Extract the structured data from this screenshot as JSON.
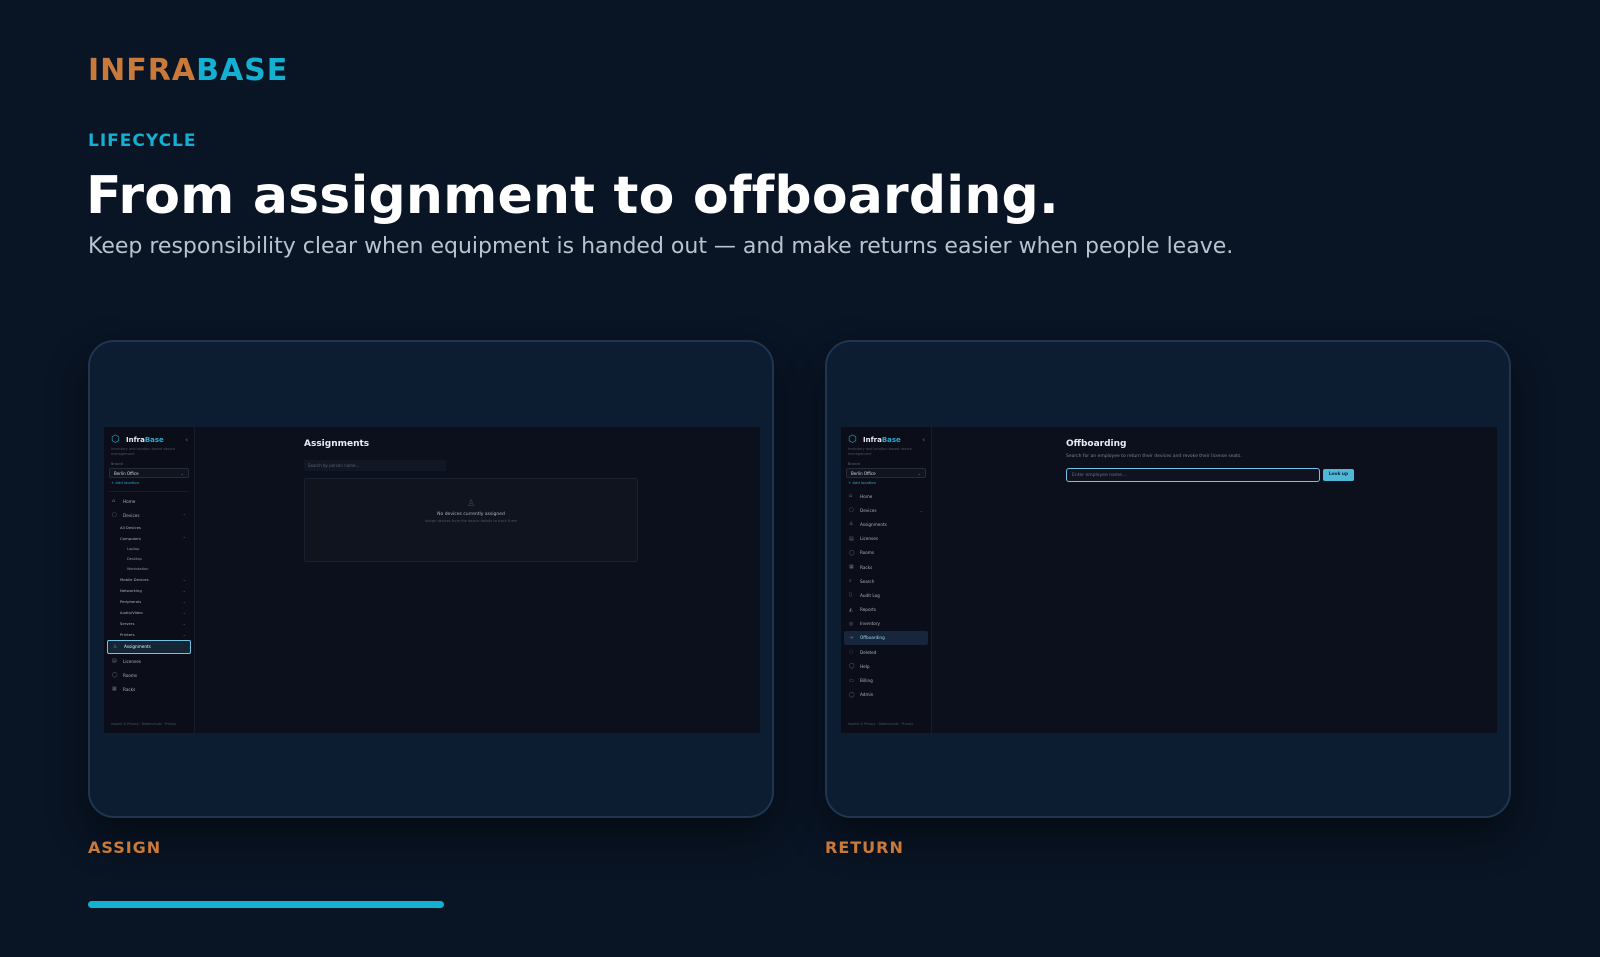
{
  "brand": {
    "part1": "INFRA",
    "part2": "BASE"
  },
  "eyebrow": "LIFECYCLE",
  "headline": "From assignment to offboarding.",
  "subhead": "Keep responsibility clear when equipment is handed out — and make returns easier when people leave.",
  "colors": {
    "accent_cyan": "#14b0d1",
    "accent_orange": "#c97a3a",
    "background": "#091424"
  },
  "cards": [
    {
      "caption": "ASSIGN",
      "app": {
        "brand_a": "Infra",
        "brand_b": "Base",
        "tagline": "Inventory and location-based device management",
        "location_label": "Branch",
        "location": "Berlin Office",
        "add_location": "+ Add location",
        "footer": "Imprint & Privacy · Datenschutz · Privacy",
        "nav": [
          {
            "label": "Home",
            "icon": "⌂"
          },
          {
            "label": "Devices",
            "icon": "▢"
          },
          {
            "label": "All Devices"
          },
          {
            "label": "Computers"
          },
          {
            "label": "Laptop"
          },
          {
            "label": "Desktop"
          },
          {
            "label": "Workstation"
          },
          {
            "label": "Mobile Devices"
          },
          {
            "label": "Networking"
          },
          {
            "label": "Peripherals"
          },
          {
            "label": "Audio/Video"
          },
          {
            "label": "Servers"
          },
          {
            "label": "Printers"
          },
          {
            "label": "Assignments",
            "icon": "♙"
          },
          {
            "label": "Licenses",
            "icon": "▤"
          },
          {
            "label": "Rooms",
            "icon": "◯"
          },
          {
            "label": "Racks",
            "icon": "▦"
          }
        ],
        "page_title": "Assignments",
        "search_placeholder": "Search by person name...",
        "empty_title": "No devices currently assigned",
        "empty_sub": "Assign devices from the device details to track them"
      }
    },
    {
      "caption": "RETURN",
      "app": {
        "brand_a": "Infra",
        "brand_b": "Base",
        "tagline": "Inventory and location-based device management",
        "location_label": "Branch",
        "location": "Berlin Office",
        "add_location": "+ Add location",
        "footer": "Imprint & Privacy · Datenschutz · Privacy",
        "nav": [
          {
            "label": "Home",
            "icon": "⌂"
          },
          {
            "label": "Devices",
            "icon": "▢"
          },
          {
            "label": "Assignments",
            "icon": "♙"
          },
          {
            "label": "Licenses",
            "icon": "▤"
          },
          {
            "label": "Rooms",
            "icon": "◯"
          },
          {
            "label": "Racks",
            "icon": "▦"
          },
          {
            "label": "Search",
            "icon": "⌕"
          },
          {
            "label": "Audit Log",
            "icon": "▯"
          },
          {
            "label": "Reports",
            "icon": "◭"
          },
          {
            "label": "Inventory",
            "icon": "◎"
          },
          {
            "label": "Offboarding",
            "icon": "⇥"
          },
          {
            "label": "Deleted",
            "icon": "◌"
          },
          {
            "label": "Help",
            "icon": "◯"
          },
          {
            "label": "Billing",
            "icon": "▭"
          },
          {
            "label": "Admin",
            "icon": "◯"
          }
        ],
        "page_title": "Offboarding",
        "page_desc": "Search for an employee to return their devices and revoke their license seats.",
        "input_placeholder": "Enter employee name...",
        "button": "Look up"
      }
    }
  ],
  "progress": 0.25
}
